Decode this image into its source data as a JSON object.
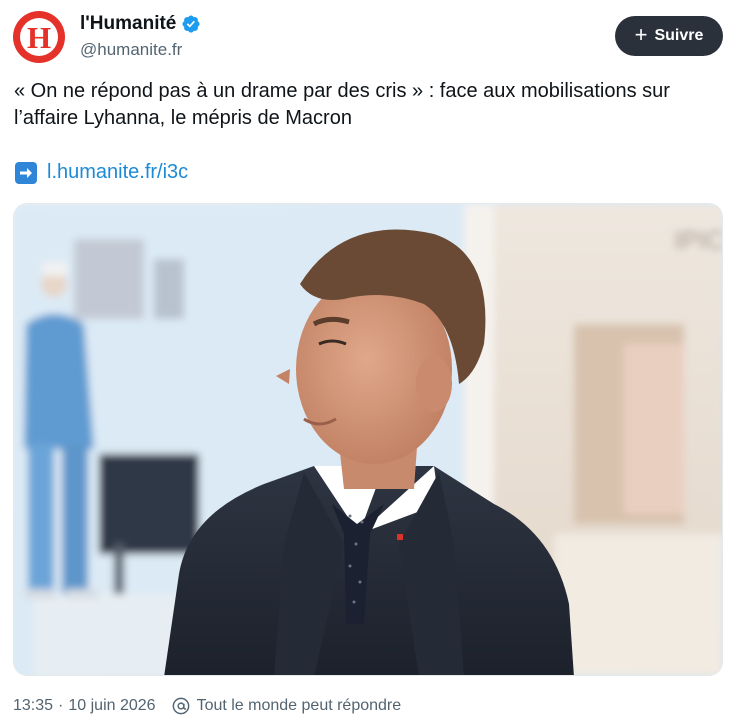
{
  "account": {
    "avatar_letter": "H",
    "name": "l'Humanité",
    "handle": "@humanite.fr",
    "verified_icon": "verified-badge-icon",
    "brand_color": "#e4322b"
  },
  "follow_button": {
    "plus": "+",
    "label": "Suivre"
  },
  "tweet": {
    "text": "« On ne répond pas à un drame par des cris » : face aux mobilisations sur l’affaire Lyhanna, le mépris de Macron",
    "link_icon": "➡",
    "link_text": "l.humanite.fr/i3c"
  },
  "media": {
    "type": "photo",
    "background_sign_text": "IPIC"
  },
  "footer": {
    "time": "13:35",
    "separator": "·",
    "date": "10 juin 2026",
    "reply_icon": "at-sign-icon",
    "reply_setting": "Tout le monde peut répondre"
  }
}
